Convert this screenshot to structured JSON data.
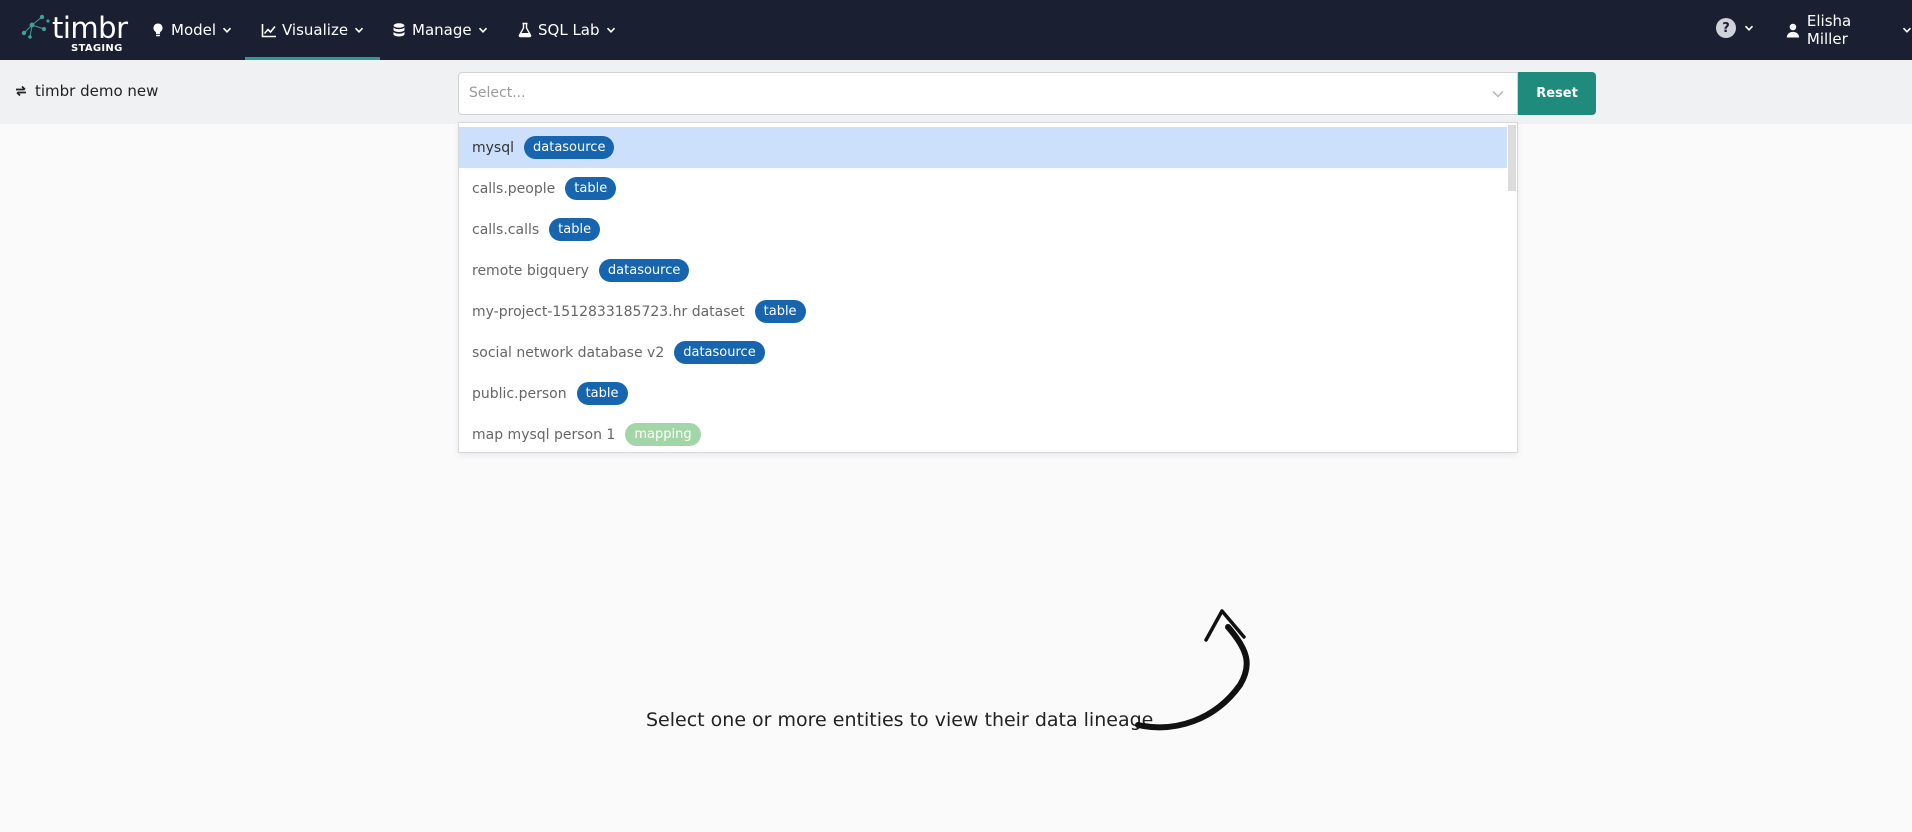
{
  "app": {
    "logo_word": "timbr",
    "environment": "STAGING"
  },
  "nav": {
    "items": [
      {
        "label": "Model",
        "icon": "lightbulb-icon",
        "active": false
      },
      {
        "label": "Visualize",
        "icon": "chart-icon",
        "active": true
      },
      {
        "label": "Manage",
        "icon": "database-icon",
        "active": false
      },
      {
        "label": "SQL Lab",
        "icon": "flask-icon",
        "active": false
      }
    ],
    "help_symbol": "?",
    "user_name": "Elisha Miller"
  },
  "toolbar": {
    "workspace_name": "timbr demo new",
    "select_placeholder": "Select...",
    "reset_label": "Reset"
  },
  "dropdown": {
    "options": [
      {
        "label": "mysql",
        "badge": "datasource",
        "highlighted": true
      },
      {
        "label": "calls.people",
        "badge": "table",
        "highlighted": false
      },
      {
        "label": "calls.calls",
        "badge": "table",
        "highlighted": false
      },
      {
        "label": "remote bigquery",
        "badge": "datasource",
        "highlighted": false
      },
      {
        "label": "my-project-1512833185723.hr dataset",
        "badge": "table",
        "highlighted": false
      },
      {
        "label": "social network database v2",
        "badge": "datasource",
        "highlighted": false
      },
      {
        "label": "public.person",
        "badge": "table",
        "highlighted": false
      },
      {
        "label": "map mysql person 1",
        "badge": "mapping",
        "highlighted": false
      }
    ]
  },
  "empty_state": {
    "message": "Select one or more entities to view their data lineage"
  },
  "colors": {
    "navbar_bg": "#1a1f31",
    "accent": "#1f8b7c",
    "badge_blue": "#1765ae",
    "badge_green": "#a3d6a7",
    "highlight": "#cce0fc"
  }
}
